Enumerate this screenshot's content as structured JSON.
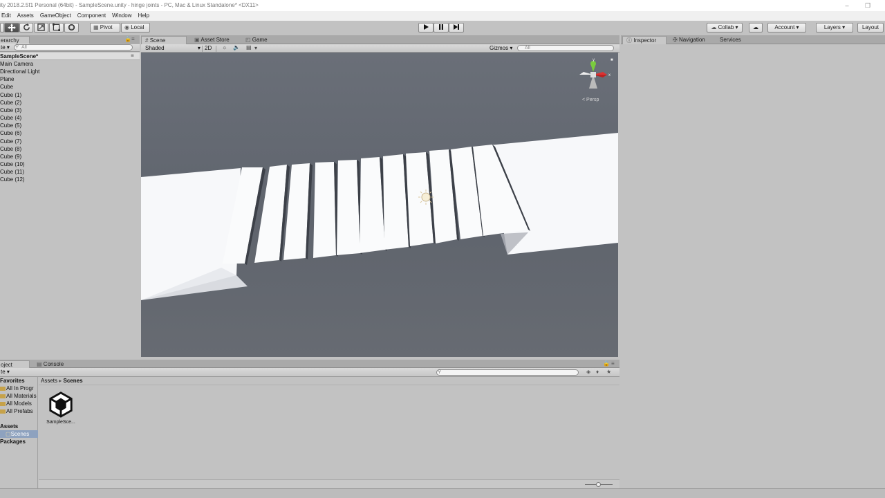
{
  "window": {
    "title": "ity 2018.2.5f1 Personal (64bit) - SampleScene.unity - hinge joints - PC, Mac & Linux Standalone* <DX11>"
  },
  "menu": [
    "Edit",
    "Assets",
    "GameObject",
    "Component",
    "Window",
    "Help"
  ],
  "toolbar": {
    "pivot_label": "Pivot",
    "local_label": "Local",
    "collab_label": "Collab",
    "account_label": "Account",
    "layers_label": "Layers",
    "layout_label": "Layout",
    "tools": [
      "hand-tool-icon",
      "move-tool-icon",
      "rotate-tool-icon",
      "scale-tool-icon",
      "rect-tool-icon",
      "transform-tool-icon"
    ]
  },
  "hierarchy": {
    "tab_label": "erarchy",
    "create_label": "te",
    "search_placeholder": "All",
    "scene_name": "SampleScene*",
    "items": [
      "Main Camera",
      "Directional Light",
      "Plane",
      "Cube",
      "Cube (1)",
      "Cube (2)",
      "Cube (3)",
      "Cube (4)",
      "Cube (5)",
      "Cube (6)",
      "Cube (7)",
      "Cube (8)",
      "Cube (9)",
      "Cube (10)",
      "Cube (11)",
      "Cube (12)"
    ]
  },
  "scene_view": {
    "tabs": [
      "Scene",
      "Asset Store",
      "Game"
    ],
    "shading_mode": "Shaded",
    "mode_2d": "2D",
    "gizmos_label": "Gizmos",
    "search_placeholder": "All",
    "projection": "Persp",
    "gizmo_axis_label": "y"
  },
  "inspector": {
    "tabs": [
      "Inspector",
      "Navigation",
      "Services"
    ]
  },
  "project": {
    "tabs": [
      "oject",
      "Console"
    ],
    "create_label": "te",
    "breadcrumb": [
      "Assets",
      "Scenes"
    ],
    "favorites_header": "Favorites",
    "favorites": [
      "All In Progr",
      "All Materials",
      "All Models",
      "All Prefabs"
    ],
    "assets_header": "Assets",
    "assets_folders": [
      "Scenes"
    ],
    "packages_header": "Packages",
    "files": [
      {
        "name": "SampleSce...",
        "icon": "unity-scene-icon"
      }
    ]
  },
  "colors": {
    "scene_bg": "#626770",
    "panel_bg": "#c2c2c2",
    "selection": "#8ea2bf",
    "accent": "#3d6fb6"
  }
}
